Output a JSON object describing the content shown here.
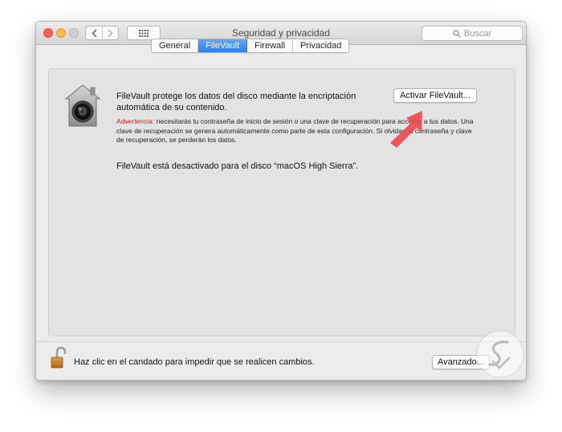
{
  "window": {
    "title": "Seguridad y privacidad",
    "search_placeholder": "Buscar"
  },
  "tabs": [
    {
      "label": "General",
      "active": false
    },
    {
      "label": "FileVault",
      "active": true
    },
    {
      "label": "Firewall",
      "active": false
    },
    {
      "label": "Privacidad",
      "active": false
    }
  ],
  "filevault": {
    "description": "FileVault protege los datos del disco mediante la encriptación automática de su contenido.",
    "activate_button": "Activar FileVault...",
    "warning_label": "Advertencia:",
    "warning_text": " necesitarás tu contraseña de inicio de sesión o una clave de recuperación para acceder a tus datos. Una clave de recuperación se genera automáticamente como parte de esta configuración. Si olvidas tu contraseña y clave de recuperación, se perderán los datos.",
    "status": "FileVault está desactivado para el disco “macOS High Sierra”."
  },
  "footer": {
    "lock_text": "Haz clic en el candado para impedir que se realicen cambios.",
    "advanced_button": "Avanzado..."
  },
  "icons": {
    "house": "filevault-house-icon",
    "lock": "padlock-open-icon",
    "arrow": "annotation-arrow-icon",
    "search": "search-icon"
  },
  "colors": {
    "accent_blue": "#2a7ff2",
    "warning_red": "#d0211b",
    "arrow_red": "#f04a4f",
    "close": "#fc605c",
    "minimize": "#fdbc40"
  }
}
